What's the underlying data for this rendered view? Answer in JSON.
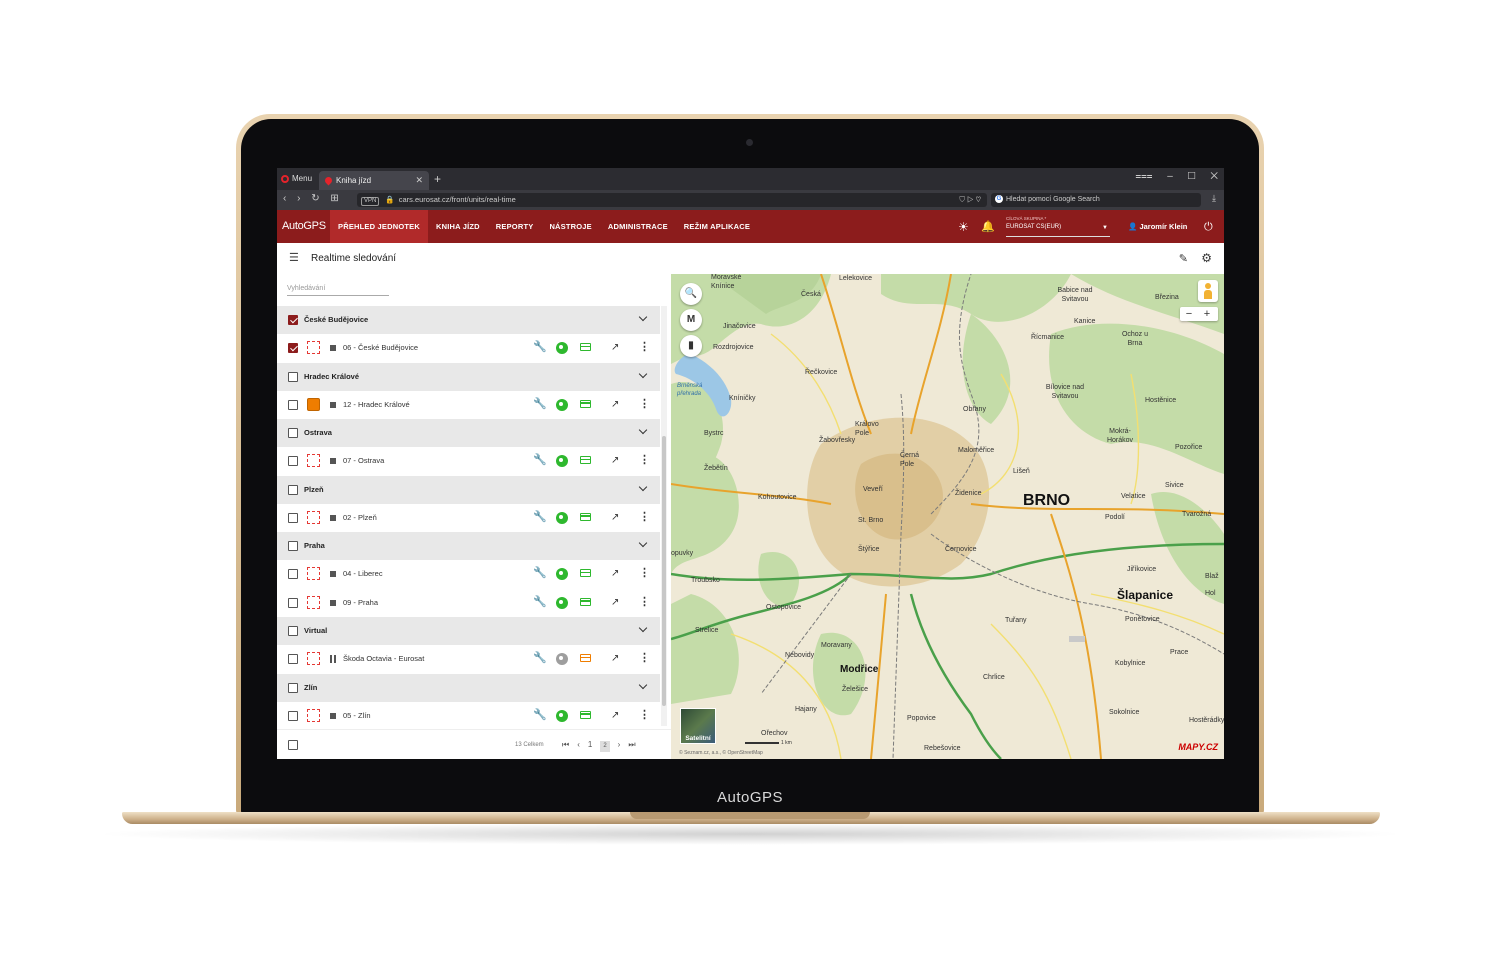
{
  "laptop": {
    "brand": "AutoGPS"
  },
  "browser": {
    "menu_label": "Menu",
    "tab_title": "Kniha jízd",
    "tab_close": "✕",
    "new_tab": "+",
    "window_controls": "⩶ – ☐ ✕",
    "nav_buttons": "‹ › ↻ ⊞",
    "vpn": "VPN",
    "url": "cars.eurosat.cz/front/units/real-time",
    "url_icons": "⛉ ▷ ♡",
    "search_placeholder": "Hledat pomocí Google Search",
    "download_icon": "⤓"
  },
  "app": {
    "logo": "AutoGPS",
    "nav": [
      {
        "label": "PŘEHLED JEDNOTEK",
        "active": true
      },
      {
        "label": "KNIHA JÍZD"
      },
      {
        "label": "REPORTY"
      },
      {
        "label": "NÁSTROJE"
      },
      {
        "label": "ADMINISTRACE"
      },
      {
        "label": "REŽIM APLIKACE"
      }
    ],
    "group_label": "CÍLOVÁ SKUPINA *",
    "group_value": "EUROSAT CS(EUR)",
    "user": "Jaromír Klein",
    "page_title": "Realtime sledování"
  },
  "icons": {
    "sun": "☀",
    "bell": "🔔",
    "power": "⏻",
    "list": "☰",
    "pencil": "✎",
    "cog": "⚙",
    "caret": "▼",
    "user": "👤",
    "wrench": "🔧",
    "trend": "↗",
    "kebab": "⋮",
    "search": "🔍",
    "m_logo": "M",
    "map": "▮"
  },
  "colors": {
    "header": "#8c1c1c",
    "active_tab": "#b12a2a",
    "green": "#2eb82e",
    "red": "#e53935",
    "orange": "#ef7d00",
    "grey": "#9e9e9e"
  },
  "list": {
    "search_placeholder": "Vyhledávání",
    "groups": [
      {
        "name": "České Budějovice",
        "checked": true,
        "units": [
          {
            "name": "06 - České Budějovice",
            "checked": true,
            "icon": "dashed",
            "state": "stop",
            "wrench": "grey",
            "gps": "green",
            "card": "green"
          }
        ]
      },
      {
        "name": "Hradec Králové",
        "units": [
          {
            "name": "12 - Hradec Králové",
            "icon": "orange",
            "state": "stop",
            "wrench": "grey",
            "gps": "green",
            "card": "green"
          }
        ]
      },
      {
        "name": "Ostrava",
        "units": [
          {
            "name": "07 - Ostrava",
            "icon": "dashed",
            "state": "stop",
            "wrench": "grey",
            "gps": "green",
            "card": "green"
          }
        ]
      },
      {
        "name": "Plzeň",
        "units": [
          {
            "name": "02 - Plzeň",
            "icon": "dashed",
            "state": "stop",
            "wrench": "green",
            "gps": "green",
            "card": "green"
          }
        ]
      },
      {
        "name": "Praha",
        "units": [
          {
            "name": "04 - Liberec",
            "icon": "dashed",
            "state": "stop",
            "wrench": "grey",
            "gps": "green",
            "card": "green"
          },
          {
            "name": "09 - Praha",
            "icon": "dashed",
            "state": "stop",
            "wrench": "red",
            "gps": "green",
            "card": "green"
          }
        ]
      },
      {
        "name": "Virtual",
        "units": [
          {
            "name": "Škoda Octavia - Eurosat",
            "icon": "dashed",
            "state": "pause",
            "wrench": "grey",
            "gps": "grey",
            "card": "orange"
          }
        ]
      },
      {
        "name": "Zlín",
        "units": [
          {
            "name": "05 - Zlín",
            "icon": "dashed",
            "state": "stop",
            "wrench": "red",
            "gps": "green",
            "card": "green"
          }
        ]
      }
    ],
    "total": "13 Celkem",
    "pager": {
      "first": "⏮",
      "prev": "‹",
      "page1": "1",
      "page2": "2",
      "next": "›",
      "last": "⏭"
    }
  },
  "map": {
    "labels": [
      {
        "t": "Moravské"
      },
      {
        "t": "Knínice"
      },
      {
        "t": "Lelekovice"
      },
      {
        "t": "Česká"
      },
      {
        "t": "Jinačovice"
      },
      {
        "t": "Rozdrojovice"
      },
      {
        "t": "Řečkovice"
      },
      {
        "t": "Kníničky"
      },
      {
        "t": "Bystrc"
      },
      {
        "t": "Žabovřesky"
      },
      {
        "t": "Královo Pole"
      },
      {
        "t": "Černá Pole"
      },
      {
        "t": "Žebětín"
      },
      {
        "t": "Veveří"
      },
      {
        "t": "Kohoutovice"
      },
      {
        "t": "St. Brno"
      },
      {
        "t": "Štýřice"
      },
      {
        "t": "Troubsko"
      },
      {
        "t": "Ostopovice"
      },
      {
        "t": "Strelice"
      },
      {
        "t": "Nebovidy"
      },
      {
        "t": "Moravany"
      },
      {
        "t": "Želešice"
      },
      {
        "t": "Hajany"
      },
      {
        "t": "Popovice"
      },
      {
        "t": "Rebešovice"
      },
      {
        "t": "Ořechov"
      },
      {
        "t": "Obřany"
      },
      {
        "t": "Maloměřice"
      },
      {
        "t": "Židenice"
      },
      {
        "t": "Lišeň"
      },
      {
        "t": "Černovice"
      },
      {
        "t": "Tuřany"
      },
      {
        "t": "Chrlice"
      },
      {
        "t": "Babice nad Svitavou"
      },
      {
        "t": "Kanice"
      },
      {
        "t": "Řícmanice"
      },
      {
        "t": "Bílovice nad Svitavou"
      },
      {
        "t": "Ochoz u Brna"
      },
      {
        "t": "Březina"
      },
      {
        "t": "Hostěnice"
      },
      {
        "t": "Mokrá-Horákov"
      },
      {
        "t": "Pozořice"
      },
      {
        "t": "Velatice"
      },
      {
        "t": "Sivice"
      },
      {
        "t": "Podolí"
      },
      {
        "t": "Tvarožná"
      },
      {
        "t": "Jiříkovice"
      },
      {
        "t": "Ponětovice"
      },
      {
        "t": "Prace"
      },
      {
        "t": "Kobylnice"
      },
      {
        "t": "Sokolnice"
      },
      {
        "t": "Hostěrádky"
      },
      {
        "t": "Blaž"
      },
      {
        "t": "Hol"
      },
      {
        "t": "Šlapanice"
      },
      {
        "t": "BRNO"
      },
      {
        "t": "Modřice"
      },
      {
        "t": "Brněnská přehrada"
      },
      {
        "t": "opuvky"
      }
    ],
    "satellite": "Satelitní",
    "scale": "1 km",
    "copyright": "© Seznam.cz, a.s., © OpenStreetMap",
    "mapy_logo": "MAPY.CZ",
    "zoom_minus": "−",
    "zoom_plus": "+"
  }
}
